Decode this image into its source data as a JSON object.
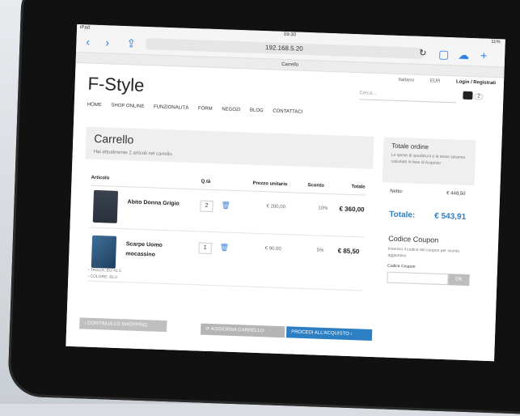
{
  "statusbar": {
    "device": "iPad",
    "time": "09:30",
    "battery": "11%"
  },
  "browser": {
    "url": "192.168.5.20",
    "tab_title": "Carrello"
  },
  "site": {
    "language": "Italiano",
    "currency": "EUR",
    "login": "Login / Registrati",
    "logo": "F-Style",
    "search_placeholder": "Cerca...",
    "cart_count": "2",
    "nav": [
      "HOME",
      "SHOP ONLINE",
      "FUNZIONALITÀ",
      "FORM",
      "NEGOZI",
      "BLOG",
      "CONTATTACI"
    ]
  },
  "cart": {
    "title": "Carrello",
    "subtitle": "Hai attualmente 2 articoli nel carrello",
    "headers": {
      "item": "Articolo",
      "qty": "Q.tà",
      "price": "Prezzo unitario",
      "discount": "Sconto",
      "total": "Totale"
    },
    "rows": [
      {
        "name": "Abito Donna Grigio",
        "qty": "2",
        "price": "€ 200,00",
        "discount": "10%",
        "total": "€ 360,00"
      },
      {
        "name": "Scarpe Uomo mocassino",
        "qty": "1",
        "price": "€ 90,00",
        "discount": "5%",
        "total": "€ 85,50"
      }
    ],
    "options": [
      "TAGLIA: EU 41.5",
      "COLORE: BLU"
    ],
    "buttons": {
      "back": "CONTINUA LO SHOPPING",
      "update": "AGGIORNA CARRELLO",
      "proceed": "PROCEDI ALL'ACQUISTO"
    }
  },
  "summary": {
    "title": "Totale ordine",
    "subtitle": "Le spese di spedizioni e le tasse saranno calcolate in fase di Acquisto",
    "net_label": "Netto:",
    "net_value": "€ 448,50",
    "total_label": "Totale:",
    "total_value": "€ 543,91",
    "coupon_title": "Codice Coupon",
    "coupon_desc": "Inserisci il codice del coupon per sconto aggiuntivo",
    "coupon_label": "Codice Coupon",
    "coupon_button": "OK"
  }
}
